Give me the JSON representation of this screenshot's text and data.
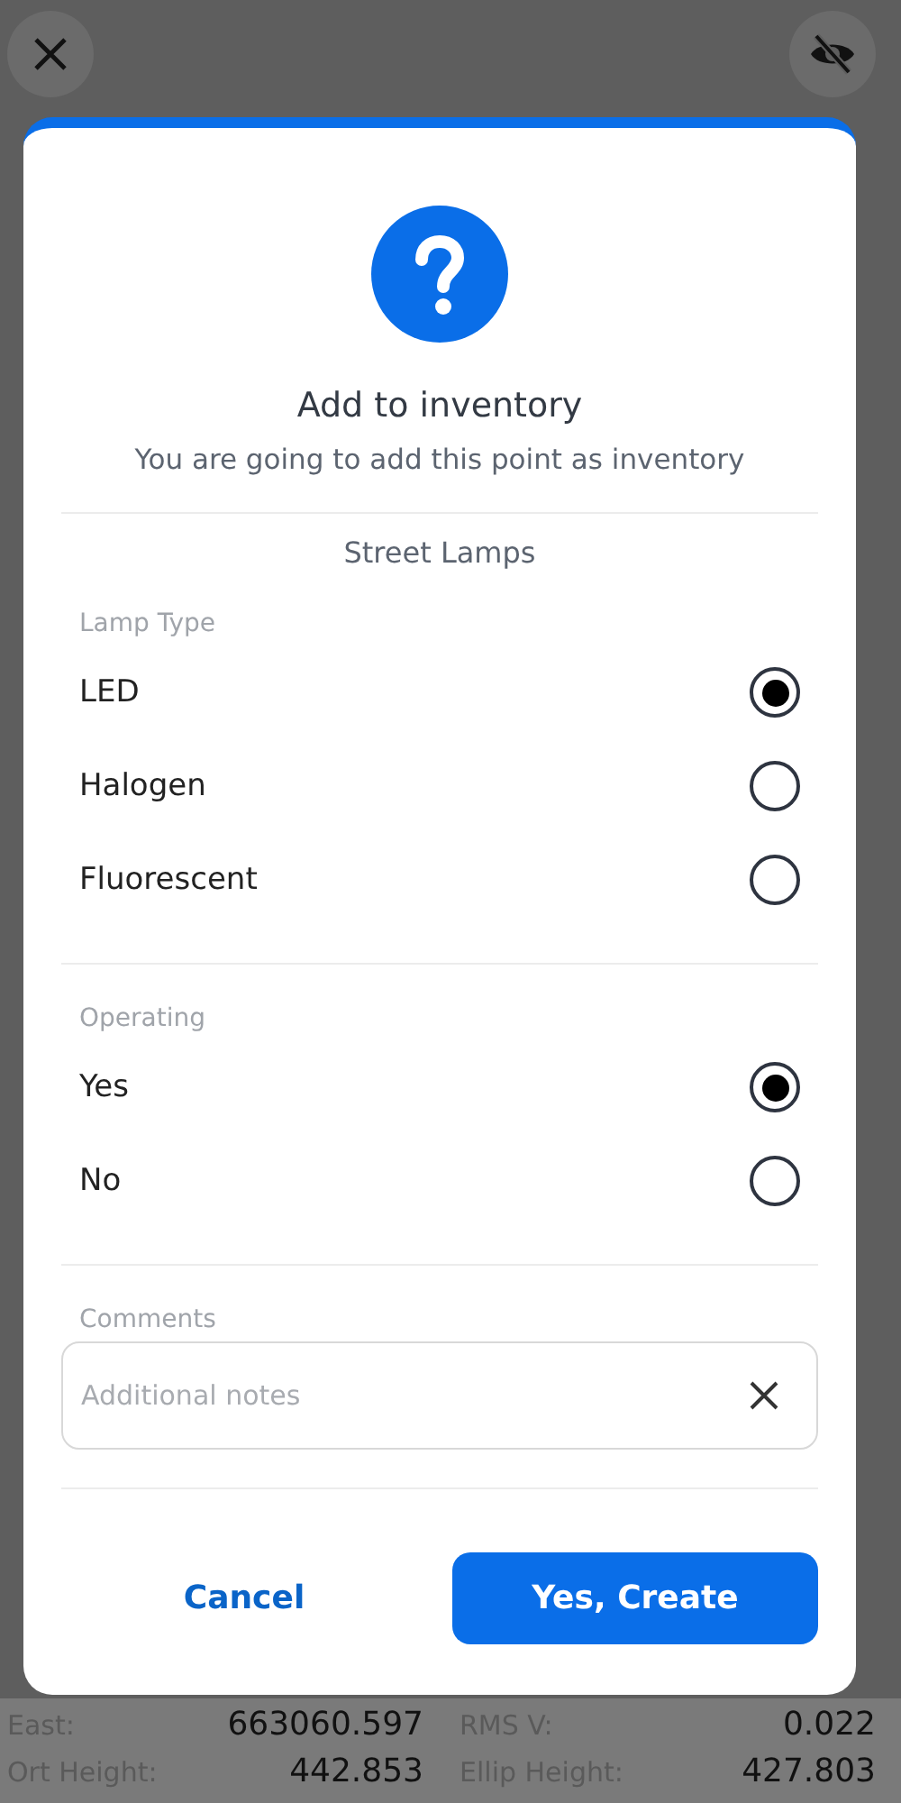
{
  "background": {
    "fields": [
      {
        "label": "East:",
        "value": "663060.597"
      },
      {
        "label": "RMS V:",
        "value": "0.022"
      },
      {
        "label": "Ort Height:",
        "value": "442.853"
      },
      {
        "label": "Ellip Height:",
        "value": "427.803"
      }
    ]
  },
  "dialog": {
    "title": "Add to inventory",
    "subtitle": "You are going to add this point as inventory",
    "category": "Street Lamps",
    "groups": [
      {
        "label": "Lamp Type",
        "options": [
          {
            "label": "LED",
            "selected": true
          },
          {
            "label": "Halogen",
            "selected": false
          },
          {
            "label": "Fluorescent",
            "selected": false
          }
        ]
      },
      {
        "label": "Operating",
        "options": [
          {
            "label": "Yes",
            "selected": true
          },
          {
            "label": "No",
            "selected": false
          }
        ]
      }
    ],
    "comments": {
      "label": "Comments",
      "placeholder": "Additional notes"
    },
    "buttons": [
      {
        "label": "Cancel",
        "kind": "text"
      },
      {
        "label": "Yes, Create",
        "kind": "primary"
      }
    ]
  }
}
